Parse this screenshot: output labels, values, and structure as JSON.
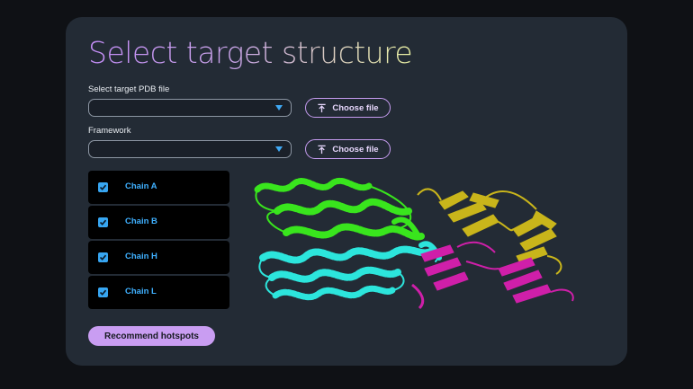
{
  "page": {
    "title": "Select target structure"
  },
  "target_pdb": {
    "label": "Select target PDB file",
    "value": "",
    "button_label": "Choose file",
    "button_icon": "upload-icon"
  },
  "framework": {
    "label": "Framework",
    "value": "",
    "button_label": "Choose file",
    "button_icon": "upload-icon"
  },
  "chains": [
    {
      "label": "Chain A",
      "checked": true
    },
    {
      "label": "Chain B",
      "checked": true
    },
    {
      "label": "Chain H",
      "checked": true
    },
    {
      "label": "Chain L",
      "checked": true
    }
  ],
  "actions": {
    "recommend_label": "Recommend hotspots"
  },
  "structure_viewer": {
    "chain_colors": {
      "green": "#39e51d",
      "cyan": "#2ce5dc",
      "yellow": "#c9b51b",
      "magenta": "#cf1fa9"
    }
  },
  "colors": {
    "background": "#0f1115",
    "card": "#232b35",
    "accent": "#c99df2",
    "checkbox": "#37a6f2",
    "chain_text": "#3fb0ff"
  }
}
